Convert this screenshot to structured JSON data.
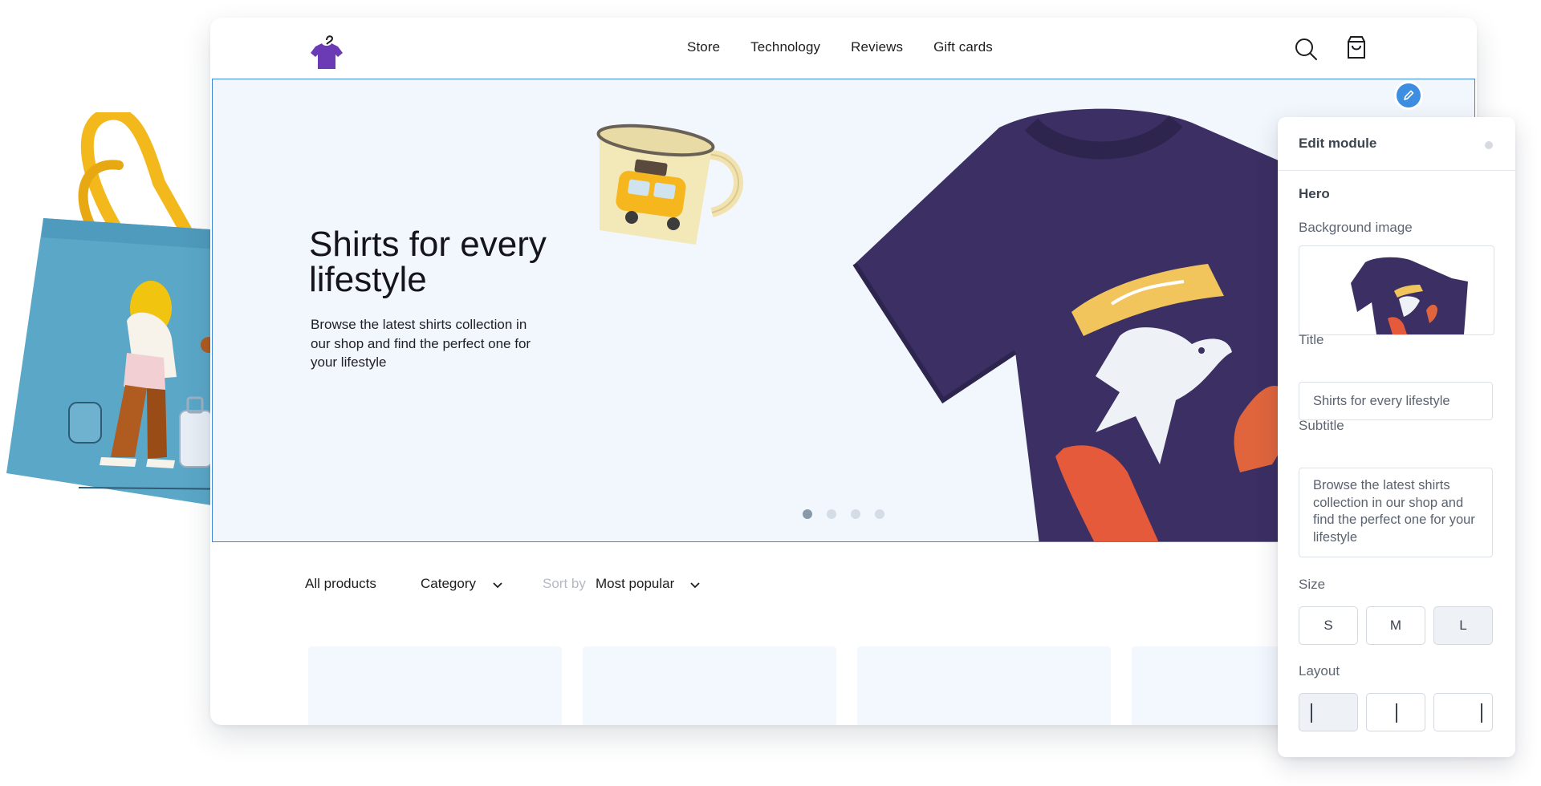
{
  "nav": {
    "links": [
      "Store",
      "Technology",
      "Reviews",
      "Gift cards"
    ],
    "logo_icon": "tshirt-hanger-logo",
    "search_icon": "search-icon",
    "cart_icon": "shopping-bag-icon"
  },
  "hero": {
    "title": "Shirts for every lifestyle",
    "subtitle": "Browse the latest shirts collection in our shop and find the perfect one for your lifestyle",
    "slides": 4,
    "active_slide": 1
  },
  "filters": {
    "all_products": "All products",
    "category": "Category",
    "sort_by_label": "Sort by",
    "sort_value": "Most popular"
  },
  "product_cards": 4,
  "edit_panel": {
    "header": "Edit module",
    "section": "Hero",
    "background_image_label": "Background image",
    "title_label": "Title",
    "title_value": "Shirts for every lifestyle",
    "subtitle_label": "Subtitle",
    "subtitle_value": "Browse the latest shirts collection in our shop and find the perfect one for your lifestyle",
    "size_label": "Size",
    "sizes": [
      "S",
      "M",
      "L"
    ],
    "selected_size": "L",
    "layout_label": "Layout",
    "layouts": [
      "left",
      "center",
      "right"
    ],
    "selected_layout": "left"
  },
  "colors": {
    "accent_blue": "#3d86d8",
    "hero_bg": "#f2f7fd",
    "shirt": "#3b2f63",
    "logo_purple": "#6b3bb6"
  }
}
